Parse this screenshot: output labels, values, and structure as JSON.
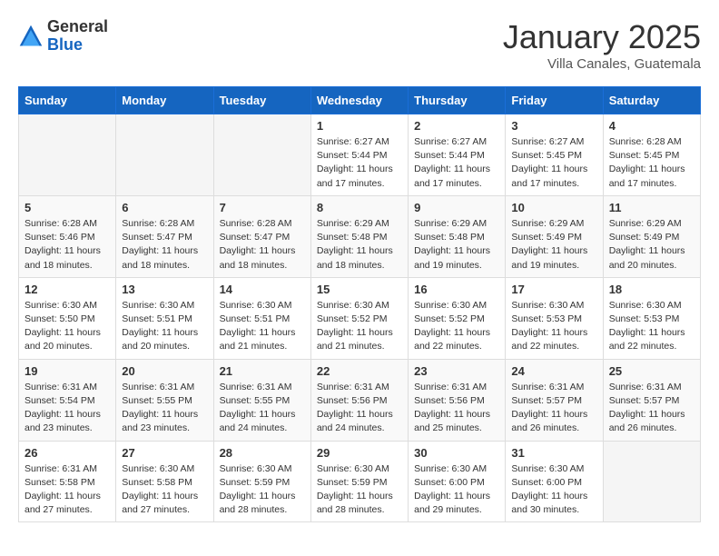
{
  "header": {
    "logo_general": "General",
    "logo_blue": "Blue",
    "month_title": "January 2025",
    "location": "Villa Canales, Guatemala"
  },
  "weekdays": [
    "Sunday",
    "Monday",
    "Tuesday",
    "Wednesday",
    "Thursday",
    "Friday",
    "Saturday"
  ],
  "weeks": [
    [
      {
        "day": "",
        "info": ""
      },
      {
        "day": "",
        "info": ""
      },
      {
        "day": "",
        "info": ""
      },
      {
        "day": "1",
        "info": "Sunrise: 6:27 AM\nSunset: 5:44 PM\nDaylight: 11 hours and 17 minutes."
      },
      {
        "day": "2",
        "info": "Sunrise: 6:27 AM\nSunset: 5:44 PM\nDaylight: 11 hours and 17 minutes."
      },
      {
        "day": "3",
        "info": "Sunrise: 6:27 AM\nSunset: 5:45 PM\nDaylight: 11 hours and 17 minutes."
      },
      {
        "day": "4",
        "info": "Sunrise: 6:28 AM\nSunset: 5:45 PM\nDaylight: 11 hours and 17 minutes."
      }
    ],
    [
      {
        "day": "5",
        "info": "Sunrise: 6:28 AM\nSunset: 5:46 PM\nDaylight: 11 hours and 18 minutes."
      },
      {
        "day": "6",
        "info": "Sunrise: 6:28 AM\nSunset: 5:47 PM\nDaylight: 11 hours and 18 minutes."
      },
      {
        "day": "7",
        "info": "Sunrise: 6:28 AM\nSunset: 5:47 PM\nDaylight: 11 hours and 18 minutes."
      },
      {
        "day": "8",
        "info": "Sunrise: 6:29 AM\nSunset: 5:48 PM\nDaylight: 11 hours and 18 minutes."
      },
      {
        "day": "9",
        "info": "Sunrise: 6:29 AM\nSunset: 5:48 PM\nDaylight: 11 hours and 19 minutes."
      },
      {
        "day": "10",
        "info": "Sunrise: 6:29 AM\nSunset: 5:49 PM\nDaylight: 11 hours and 19 minutes."
      },
      {
        "day": "11",
        "info": "Sunrise: 6:29 AM\nSunset: 5:49 PM\nDaylight: 11 hours and 20 minutes."
      }
    ],
    [
      {
        "day": "12",
        "info": "Sunrise: 6:30 AM\nSunset: 5:50 PM\nDaylight: 11 hours and 20 minutes."
      },
      {
        "day": "13",
        "info": "Sunrise: 6:30 AM\nSunset: 5:51 PM\nDaylight: 11 hours and 20 minutes."
      },
      {
        "day": "14",
        "info": "Sunrise: 6:30 AM\nSunset: 5:51 PM\nDaylight: 11 hours and 21 minutes."
      },
      {
        "day": "15",
        "info": "Sunrise: 6:30 AM\nSunset: 5:52 PM\nDaylight: 11 hours and 21 minutes."
      },
      {
        "day": "16",
        "info": "Sunrise: 6:30 AM\nSunset: 5:52 PM\nDaylight: 11 hours and 22 minutes."
      },
      {
        "day": "17",
        "info": "Sunrise: 6:30 AM\nSunset: 5:53 PM\nDaylight: 11 hours and 22 minutes."
      },
      {
        "day": "18",
        "info": "Sunrise: 6:30 AM\nSunset: 5:53 PM\nDaylight: 11 hours and 22 minutes."
      }
    ],
    [
      {
        "day": "19",
        "info": "Sunrise: 6:31 AM\nSunset: 5:54 PM\nDaylight: 11 hours and 23 minutes."
      },
      {
        "day": "20",
        "info": "Sunrise: 6:31 AM\nSunset: 5:55 PM\nDaylight: 11 hours and 23 minutes."
      },
      {
        "day": "21",
        "info": "Sunrise: 6:31 AM\nSunset: 5:55 PM\nDaylight: 11 hours and 24 minutes."
      },
      {
        "day": "22",
        "info": "Sunrise: 6:31 AM\nSunset: 5:56 PM\nDaylight: 11 hours and 24 minutes."
      },
      {
        "day": "23",
        "info": "Sunrise: 6:31 AM\nSunset: 5:56 PM\nDaylight: 11 hours and 25 minutes."
      },
      {
        "day": "24",
        "info": "Sunrise: 6:31 AM\nSunset: 5:57 PM\nDaylight: 11 hours and 26 minutes."
      },
      {
        "day": "25",
        "info": "Sunrise: 6:31 AM\nSunset: 5:57 PM\nDaylight: 11 hours and 26 minutes."
      }
    ],
    [
      {
        "day": "26",
        "info": "Sunrise: 6:31 AM\nSunset: 5:58 PM\nDaylight: 11 hours and 27 minutes."
      },
      {
        "day": "27",
        "info": "Sunrise: 6:30 AM\nSunset: 5:58 PM\nDaylight: 11 hours and 27 minutes."
      },
      {
        "day": "28",
        "info": "Sunrise: 6:30 AM\nSunset: 5:59 PM\nDaylight: 11 hours and 28 minutes."
      },
      {
        "day": "29",
        "info": "Sunrise: 6:30 AM\nSunset: 5:59 PM\nDaylight: 11 hours and 28 minutes."
      },
      {
        "day": "30",
        "info": "Sunrise: 6:30 AM\nSunset: 6:00 PM\nDaylight: 11 hours and 29 minutes."
      },
      {
        "day": "31",
        "info": "Sunrise: 6:30 AM\nSunset: 6:00 PM\nDaylight: 11 hours and 30 minutes."
      },
      {
        "day": "",
        "info": ""
      }
    ]
  ]
}
